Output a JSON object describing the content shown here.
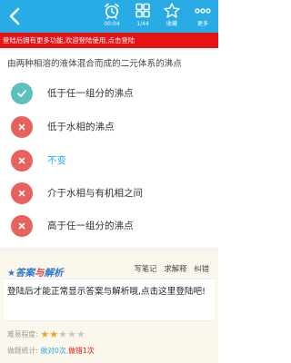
{
  "header": {
    "timer_value": "00:04",
    "progress_label": "1/44",
    "favorite_label": "收藏",
    "more_label": "更多"
  },
  "banner": {
    "text": "登陆后拥有更多功能,欢迎登陆使用,点击登陆"
  },
  "question": {
    "text": "由两种相溶的液体混合而成的二元体系的沸点"
  },
  "options": [
    {
      "label": "低于任一组分的沸点",
      "state": "correct",
      "icon": "check-icon"
    },
    {
      "label": "低于水相的沸点",
      "state": "wrong",
      "icon": "x-icon"
    },
    {
      "label": "不变",
      "state": "selected",
      "icon": "x-icon"
    },
    {
      "label": "介于水相与有机相之间",
      "state": "wrong",
      "icon": "x-icon"
    },
    {
      "label": "高于任一组分的沸点",
      "state": "wrong",
      "icon": "x-icon"
    }
  ],
  "answer": {
    "logo_star": "★",
    "logo_part1": "答案",
    "logo_part2": "与",
    "logo_part3": "解析",
    "notes_link": "写笔记",
    "explain_link": "求解释",
    "report_link": "纠错",
    "message": "登陆后才能正常显示答案与解析哦,点击这里登陆吧!"
  },
  "stats": {
    "difficulty_label": "难易程度:",
    "difficulty_rating": 2,
    "difficulty_max": 5,
    "record_label": "做题统计:",
    "correct_text": "做对0次",
    "separator": ",",
    "wrong_text": "做错1次"
  },
  "colors": {
    "header_bg": "#29ace6",
    "banner_bg": "#e71313",
    "correct": "#5bc0be",
    "wrong": "#e8625d",
    "selected_text": "#29ace6",
    "star_on": "#f2a01c",
    "star_off": "#c8c8c8",
    "logo_blue": "#2b78d0",
    "logo_red": "#e23c3c"
  }
}
